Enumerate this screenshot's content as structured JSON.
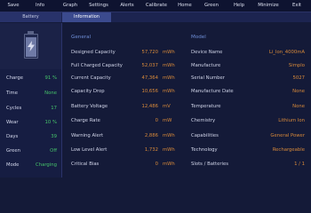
{
  "menu": [
    "Save",
    "Info",
    "Graph",
    "Settings",
    "Alerts",
    "Calibrate",
    "Home",
    "Green",
    "Help",
    "Minimize",
    "Exit"
  ],
  "tabs": [
    "Battery",
    "Information"
  ],
  "left": {
    "rows": [
      {
        "k": "Charge",
        "v": "91 %"
      },
      {
        "k": "Time",
        "v": "None"
      },
      {
        "k": "Cycles",
        "v": "17"
      },
      {
        "k": "Wear",
        "v": "10 %"
      },
      {
        "k": "Days",
        "v": "39"
      },
      {
        "k": "Green",
        "v": "Off"
      },
      {
        "k": "Mode",
        "v": "Charging"
      }
    ],
    "charge_level": 0.91
  },
  "general": {
    "title": "General",
    "rows": [
      {
        "k": "Designed Capacity",
        "v": "57,720",
        "u": "mWh"
      },
      {
        "k": "Full Charged Capacity",
        "v": "52,037",
        "u": "mWh"
      },
      {
        "k": "Current Capacity",
        "v": "47,364",
        "u": "mWh"
      },
      {
        "k": "Capacity Drop",
        "v": "10,656",
        "u": "mWh"
      },
      {
        "k": "Battery Voltage",
        "v": "12,486",
        "u": "mV"
      },
      {
        "k": "Charge Rate",
        "v": "0",
        "u": "mW"
      },
      {
        "k": "Warning Alert",
        "v": "2,886",
        "u": "mWh"
      },
      {
        "k": "Low Level Alert",
        "v": "1,732",
        "u": "mWh"
      },
      {
        "k": "Critical Bias",
        "v": "0",
        "u": "mWh"
      }
    ]
  },
  "model": {
    "title": "Model",
    "rows": [
      {
        "k": "Device Name",
        "v": "Li_Ion_4000mA"
      },
      {
        "k": "Manufacture",
        "v": "Simplo"
      },
      {
        "k": "Serial Number",
        "v": "5027"
      },
      {
        "k": "Manufacture Date",
        "v": "None"
      },
      {
        "k": "Temperature",
        "v": "None"
      },
      {
        "k": "Chemistry",
        "v": "Lithium Ion"
      },
      {
        "k": "Capabilities",
        "v": "General Power"
      },
      {
        "k": "Technology",
        "v": "Rechargeable"
      },
      {
        "k": "Slots / Batteries",
        "v": "1 / 1"
      }
    ]
  }
}
